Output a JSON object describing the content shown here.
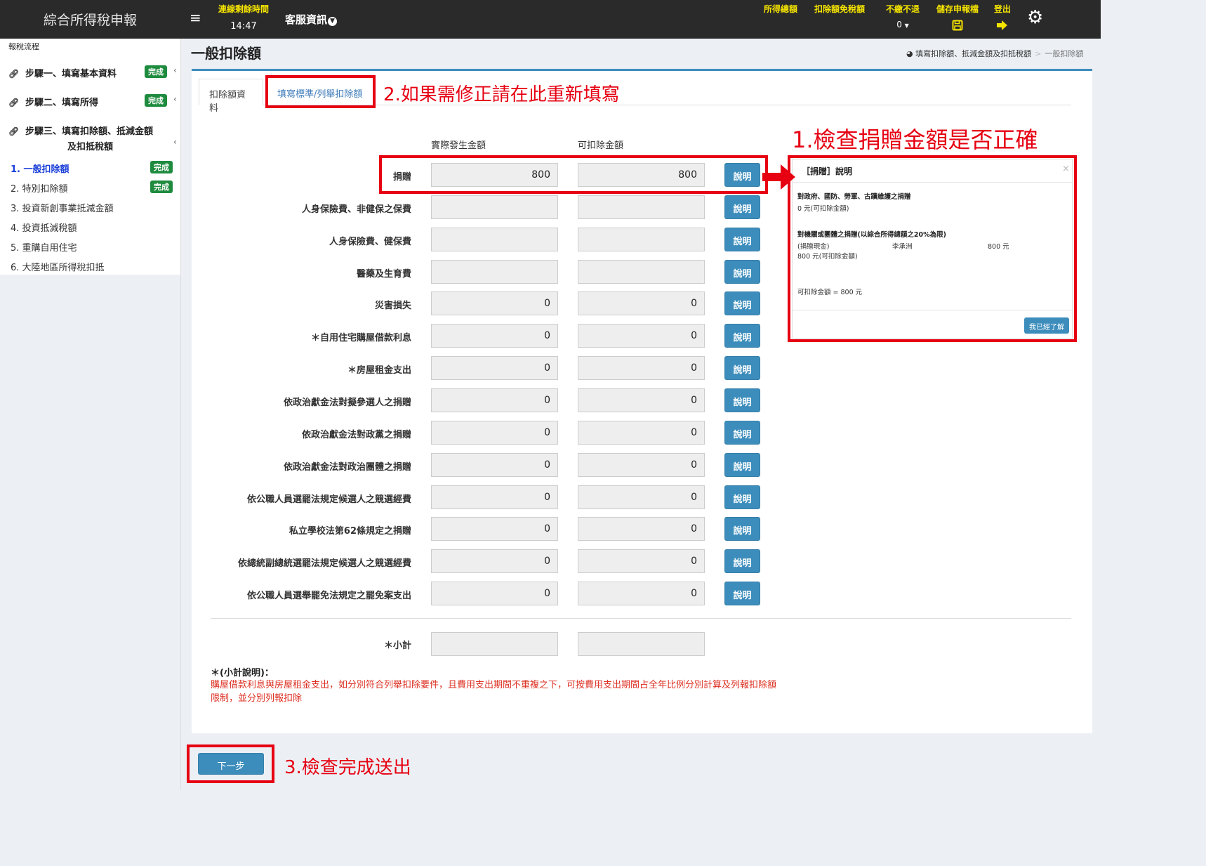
{
  "header": {
    "app_title": "綜合所得稅申報",
    "menu_icon": "≡",
    "timer_label": "連線剩餘時間",
    "timer_value": "14:47",
    "customer_service": "客服資訊",
    "total_income": "所得總額",
    "deduction_exemption": "扣除額免稅額",
    "refund_label": "不繳不退",
    "refund_value": "0",
    "save_label": "儲存申報檔",
    "logout_label": "登出",
    "colors": {
      "bar": "#2a2a2a",
      "highlight": "#f5e400"
    }
  },
  "sidebar": {
    "header": "報稅流程",
    "steps": [
      {
        "label": "步驟一、填寫基本資料",
        "badge": "完成"
      },
      {
        "label": "步驟二、填寫所得",
        "badge": "完成"
      },
      {
        "label_line1": "步驟三、填寫扣除額、抵減金額",
        "label_line2": "及扣抵稅額"
      }
    ],
    "sub_items": [
      {
        "label": "1. 一般扣除額",
        "badge": "完成"
      },
      {
        "label": "2. 特別扣除額",
        "badge": "完成"
      },
      {
        "label": "3. 投資新創事業抵減金額"
      },
      {
        "label": "4. 投資抵減稅額"
      },
      {
        "label": "5. 重購自用住宅"
      },
      {
        "label": "6. 大陸地區所得稅扣抵"
      }
    ],
    "badge_color": "#1e8b3e"
  },
  "main": {
    "page_title": "一般扣除額",
    "breadcrumb": [
      "填寫扣除額、抵減金額及扣抵稅額",
      "一般扣除額"
    ],
    "tabs": [
      "扣除額資料",
      "填寫標準/列舉扣除額"
    ],
    "col_actual": "實際發生金額",
    "col_deductible": "可扣除金額",
    "help_label": "說明",
    "rows": [
      {
        "label": "捐贈",
        "actual": "800",
        "deductible": "800"
      },
      {
        "label": "人身保險費、非健保之保費",
        "actual": "",
        "deductible": ""
      },
      {
        "label": "人身保險費、健保費",
        "actual": "",
        "deductible": ""
      },
      {
        "label": "醫藥及生育費",
        "actual": "",
        "deductible": ""
      },
      {
        "label": "災害損失",
        "actual": "0",
        "deductible": "0"
      },
      {
        "label": "＊自用住宅購屋借款利息",
        "actual": "0",
        "deductible": "0"
      },
      {
        "label": "＊房屋租金支出",
        "actual": "0",
        "deductible": "0"
      },
      {
        "label": "依政治獻金法對擬參選人之捐贈",
        "actual": "0",
        "deductible": "0"
      },
      {
        "label": "依政治獻金法對政黨之捐贈",
        "actual": "0",
        "deductible": "0"
      },
      {
        "label": "依政治獻金法對政治團體之捐贈",
        "actual": "0",
        "deductible": "0"
      },
      {
        "label": "依公職人員選罷法規定候選人之競選經費",
        "actual": "0",
        "deductible": "0"
      },
      {
        "label": "私立學校法第62條規定之捐贈",
        "actual": "0",
        "deductible": "0"
      },
      {
        "label": "依總統副總統選罷法規定候選人之競選經費",
        "actual": "0",
        "deductible": "0"
      },
      {
        "label": "依公職人員選舉罷免法規定之罷免案支出",
        "actual": "0",
        "deductible": "0"
      }
    ],
    "subtotal_label": "＊小計",
    "subtotal_actual": "",
    "subtotal_deductible": "",
    "note_title": "＊(小計說明)：",
    "note_text": "購屋借款利息與房屋租金支出，如分別符合列舉扣除要件，且費用支出期間不重複之下，可按費用支出期間占全年比例分別計算及列報扣除額限制，並分別列報扣除",
    "next_button": "下一步"
  },
  "modal": {
    "title": "［捐贈］說明",
    "close": "×",
    "sec1_title": "對政府、國防、勞軍、古蹟維護之捐贈",
    "sec1_value": "0 元(可扣除金額)",
    "sec2_title": "對機關或團體之捐贈(以綜合所得總額之20%為限)",
    "sec2_type": "(捐贈現金)",
    "sec2_name": "李承洲",
    "sec2_amount": "800 元",
    "sec2_value": "800 元(可扣除金額)",
    "total": "可扣除金額 = 800 元",
    "button": "我已經了解"
  },
  "annotations": {
    "a1": "1.檢查捐贈金額是否正確",
    "a2": "2.如果需修正請在此重新填寫",
    "a3": "3.檢查完成送出",
    "color": "#e60012"
  }
}
